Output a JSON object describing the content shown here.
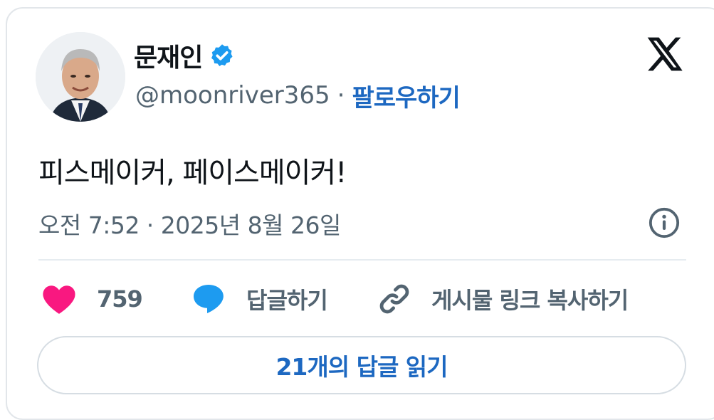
{
  "author": {
    "name": "문재인",
    "handle": "@moonriver365",
    "separator": "·",
    "follow_label": "팔로우하기",
    "verified": true
  },
  "tweet": {
    "text": "피스메이커, 페이스메이커!",
    "timestamp": "오전 7:52 · 2025년 8월 26일"
  },
  "actions": {
    "like_count": "759",
    "reply_label": "답글하기",
    "copy_link_label": "게시물 링크 복사하기"
  },
  "read_replies_label": "21개의 답글 읽기",
  "icons": {
    "logo": "x-logo-icon",
    "verified": "verified-badge-icon",
    "info": "info-icon",
    "like": "heart-icon",
    "reply": "speech-bubble-icon",
    "copy": "link-icon"
  },
  "colors": {
    "accent": "#1d68c1",
    "verified": "#1d9bf0",
    "heart": "#f91880",
    "muted": "#536471",
    "text": "#0f1419"
  }
}
